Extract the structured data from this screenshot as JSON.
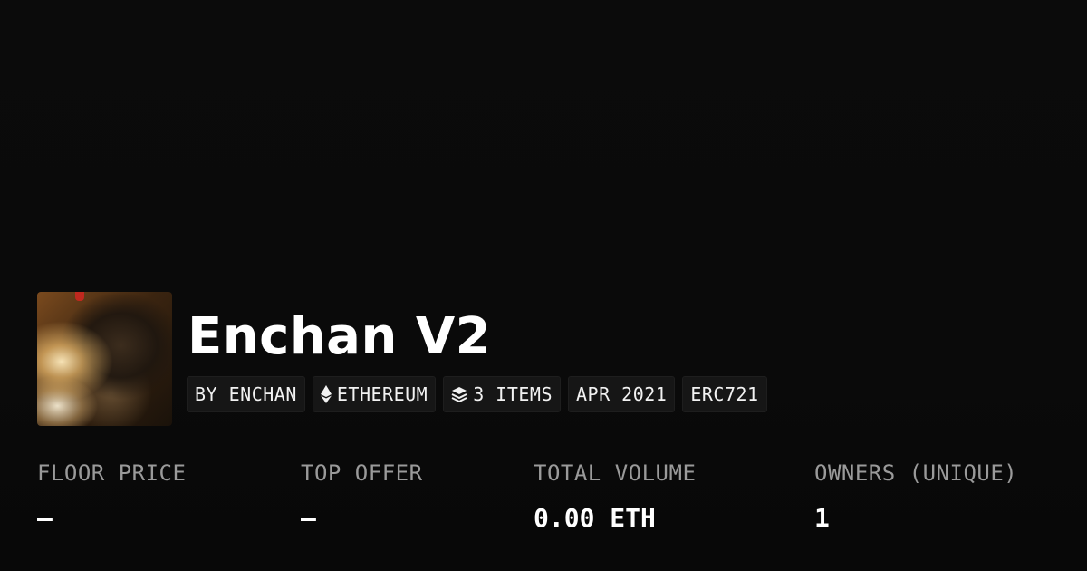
{
  "collection": {
    "name": "Enchan V2",
    "image_alt": "collection-avatar"
  },
  "tags": [
    {
      "label": "BY ENCHAN",
      "icon": ""
    },
    {
      "label": "ETHEREUM",
      "icon": "ethereum-icon"
    },
    {
      "label": "3 ITEMS",
      "icon": "layers-icon"
    },
    {
      "label": "APR 2021",
      "icon": ""
    },
    {
      "label": "ERC721",
      "icon": ""
    }
  ],
  "stats": [
    {
      "label": "FLOOR PRICE",
      "value": "–"
    },
    {
      "label": "TOP OFFER",
      "value": "–"
    },
    {
      "label": "TOTAL VOLUME",
      "value": "0.00 ETH"
    },
    {
      "label": "OWNERS (UNIQUE)",
      "value": "1"
    }
  ],
  "colors": {
    "background": "#0a0a0a",
    "tag_background": "#161616",
    "label_gray": "#9a9a9a",
    "text": "#ffffff"
  }
}
